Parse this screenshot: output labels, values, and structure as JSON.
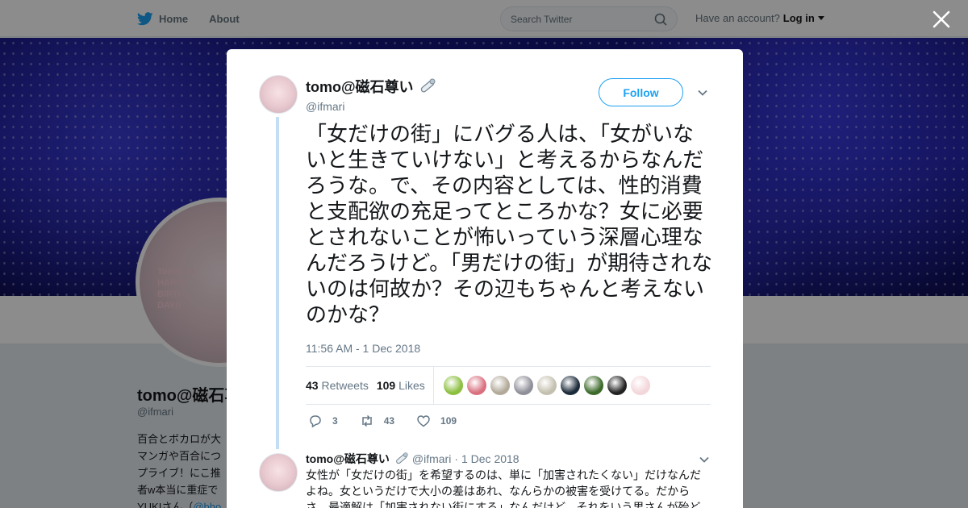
{
  "nav": {
    "home": "Home",
    "about": "About"
  },
  "search": {
    "placeholder": "Search Twitter"
  },
  "account": {
    "prompt": "Have an account?",
    "login": "Log in"
  },
  "profile": {
    "avatar_caption": "Tomo ZA\nHAPPY\nBIRTH\nDAY!!",
    "name": "tomo@磁石尊い",
    "handle": "@ifmari",
    "bio_lines": [
      "百合とボカロが大",
      "マンガや百合につ",
      "プライブ！にこ推",
      "者w本当に重症で"
    ],
    "bio_last": "YUKIさん（",
    "bio_link": "@bho"
  },
  "tweet": {
    "author_name": "tomo@磁石尊い",
    "author_handle": "@ifmari",
    "follow_label": "Follow",
    "text": "「女だけの街」にバグる人は、「女がいないと生きていけない」と考えるからなんだろうな。で、その内容としては、性的消費と支配欲の充足ってところかな？女に必要とされないことが怖いっていう深層心理なんだろうけど。「男だけの街」が期待されないのは何故か？その辺もちゃんと考えないのかな？",
    "timestamp": "11:56 AM - 1 Dec 2018",
    "retweets_count": "43",
    "retweets_label": "Retweets",
    "likes_count": "109",
    "likes_label": "Likes",
    "replies": "3",
    "retweets": "43",
    "likes": "109"
  },
  "liker_avatar_colors": [
    "#8bbf3f",
    "#d9707f",
    "#b2a999",
    "#8f8f99",
    "#c4c0b0",
    "#1c2a3a",
    "#3d6b2b",
    "#222222",
    "#f3d6da"
  ],
  "reply": {
    "name": "tomo@磁石尊い",
    "handle": "@ifmari",
    "separator": "·",
    "date": "1 Dec 2018",
    "text": "女性が「女だけの街」を希望するのは、単に「加害されたくない」だけなんだよね。女というだけで大小の差はあれ、なんらかの被害を受けてる。だからさ、最適解は「加害されない街にする」なんだけど、それをいう男さんが殆ど"
  },
  "colors": {
    "accent": "#1da1f2",
    "muted": "#657786",
    "thread": "#c4def5"
  }
}
